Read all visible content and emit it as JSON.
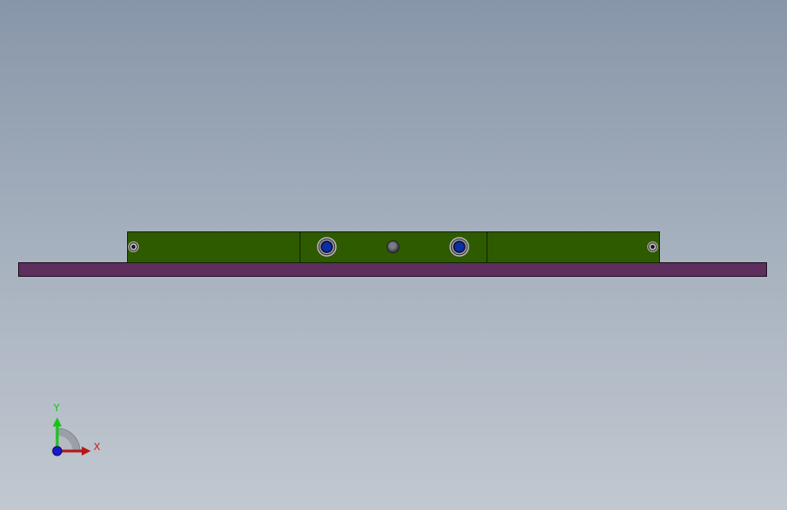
{
  "viewport": {
    "background_top": "#8796a9",
    "background_bottom": "#c1c8d0"
  },
  "model": {
    "base_plate_color": "#5e2e5e",
    "rail_color": "#2e5a00",
    "bolt_color": "#0a2fa0",
    "pin_color": "#5b5b66"
  },
  "triad": {
    "y_label": "Y",
    "x_label": "X",
    "y_color": "#17c417",
    "x_color": "#d21e1e",
    "z_color": "#1a1acc"
  }
}
